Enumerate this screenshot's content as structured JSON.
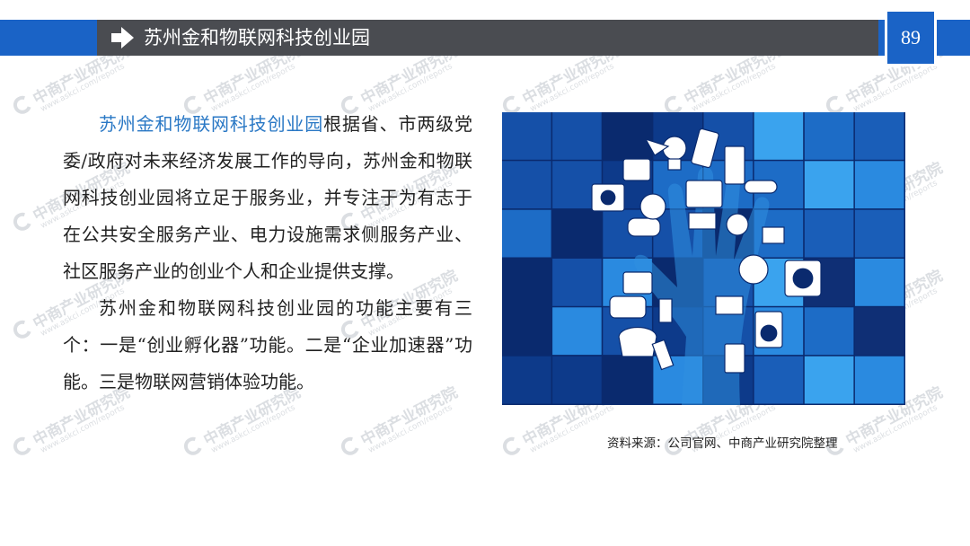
{
  "header": {
    "title": "苏州金和物联网科技创业园",
    "page_number": "89"
  },
  "body": {
    "paragraph1_highlight": "苏州金和物联网科技创业园",
    "paragraph1_rest": "根据省、市两级党委/政府对未来经济发展工作的导向，苏州金和物联网科技创业园将立足于服务业，并专注于为有志于在公共安全服务产业、电力设施需求侧服务产业、社区服务产业的创业个人和企业提供支撑。",
    "paragraph2": "苏州金和物联网科技创业园的功能主要有三个：一是“创业孵化器”功能。二是“企业加速器”功能。三是物联网营销体验功能。"
  },
  "illustration": {
    "icon": "hand-with-iot-devices-icon"
  },
  "source_caption": "资料来源：公司官网、中商产业研究院整理",
  "watermark": {
    "name": "中商产业研究院",
    "url": "www.askci.com/reports"
  },
  "colors": {
    "accent_blue": "#1a63c6",
    "header_gray": "#4a4c51",
    "highlight_text": "#2a78c5"
  }
}
